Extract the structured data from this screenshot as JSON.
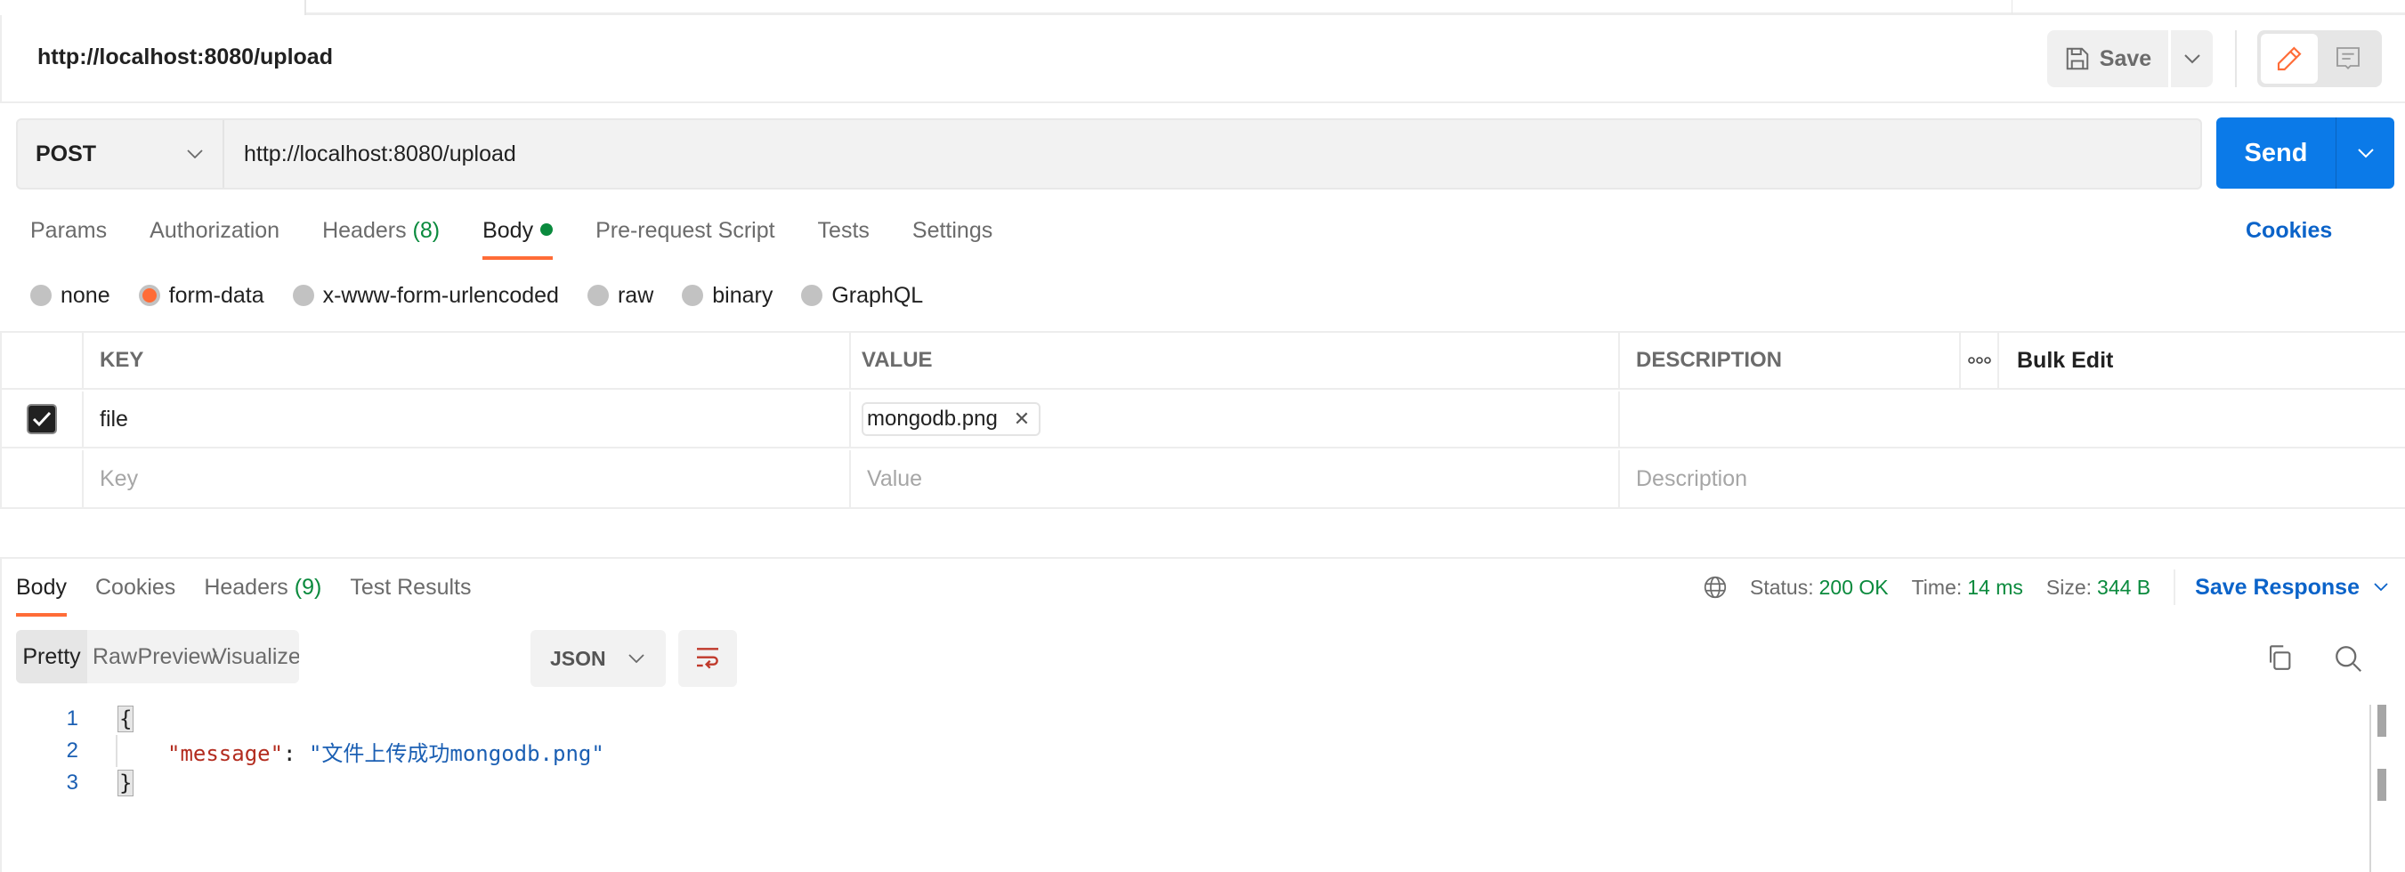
{
  "header": {
    "title": "http://localhost:8080/upload",
    "save_label": "Save"
  },
  "request": {
    "method": "POST",
    "url": "http://localhost:8080/upload",
    "send_label": "Send"
  },
  "request_tabs": {
    "params": "Params",
    "authorization": "Authorization",
    "headers": "Headers",
    "headers_count": "(8)",
    "body": "Body",
    "pre_request": "Pre-request Script",
    "tests": "Tests",
    "settings": "Settings",
    "cookies": "Cookies",
    "active": "Body"
  },
  "body_types": {
    "none": "none",
    "form_data": "form-data",
    "urlencoded": "x-www-form-urlencoded",
    "raw": "raw",
    "binary": "binary",
    "graphql": "GraphQL",
    "selected": "form-data"
  },
  "params_table": {
    "headers": {
      "key": "KEY",
      "value": "VALUE",
      "description": "DESCRIPTION",
      "more": "ooo",
      "bulk_edit": "Bulk Edit"
    },
    "rows": [
      {
        "checked": true,
        "key": "file",
        "value_file": "mongodb.png",
        "description": ""
      }
    ],
    "placeholders": {
      "key": "Key",
      "value": "Value",
      "description": "Description"
    }
  },
  "response": {
    "tabs": {
      "body": "Body",
      "cookies": "Cookies",
      "headers": "Headers",
      "headers_count": "(9)",
      "test_results": "Test Results",
      "active": "Body"
    },
    "status_label": "Status:",
    "status_value": "200 OK",
    "time_label": "Time:",
    "time_value": "14 ms",
    "size_label": "Size:",
    "size_value": "344 B",
    "save_response": "Save Response",
    "view_modes": [
      "Pretty",
      "Raw",
      "Preview",
      "Visualize"
    ],
    "active_view": "Pretty",
    "format": "JSON",
    "code_lines": [
      {
        "n": "1",
        "open": "{"
      },
      {
        "n": "2",
        "key": "\"message\"",
        "colon": ": ",
        "value": "\"文件上传成功mongodb.png\""
      },
      {
        "n": "3",
        "close": "}"
      }
    ]
  },
  "colors": {
    "accent_orange": "#ff6c37",
    "send_blue": "#0b7ae8",
    "link_blue": "#0b63c9",
    "success_green": "#0a8a3d"
  }
}
